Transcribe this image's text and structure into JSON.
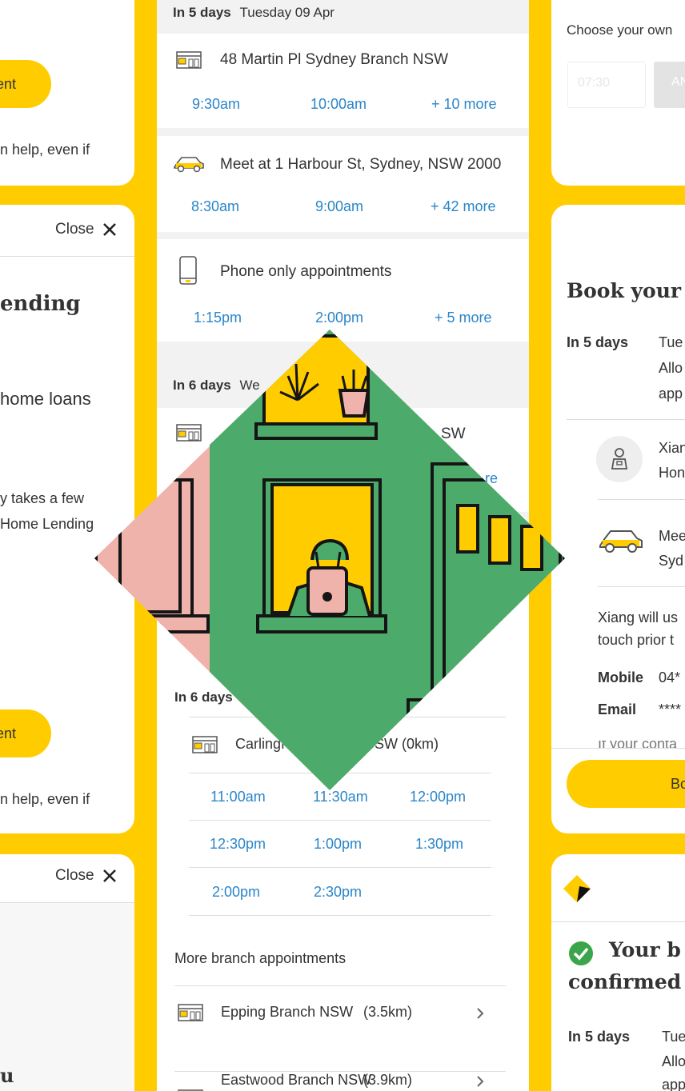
{
  "left": {
    "card1": {
      "button": "ment",
      "text": "n help, even if"
    },
    "card2": {
      "close": "Close",
      "title": "ending",
      "sub": "home loans",
      "para1": "y takes a few",
      "para2": "Home Lending",
      "button": "ment",
      "text": "n help, even if"
    },
    "card3": {
      "close": "Close",
      "bottom": "u"
    }
  },
  "middle": {
    "groups": [
      {
        "days": "In 5 days",
        "date": "Tuesday 09 Apr"
      },
      {
        "days": "In 6 days",
        "date": "We"
      }
    ],
    "options": [
      {
        "icon": "branch-icon",
        "label": "48 Martin Pl Sydney Branch NSW",
        "slots": [
          "9:30am",
          "10:00am",
          "+ 10 more"
        ]
      },
      {
        "icon": "car-icon",
        "label": "Meet at 1 Harbour St, Sydney, NSW 2000",
        "slots": [
          "8:30am",
          "9:00am",
          "+ 42 more"
        ]
      },
      {
        "icon": "phone-icon",
        "label": "Phone only appointments",
        "slots": [
          "1:15pm",
          "2:00pm",
          "+ 5 more"
        ]
      }
    ],
    "partial": {
      "sw": "SW",
      "more": "re"
    },
    "lower": {
      "days": "In 6 days",
      "branch": "Carlingf",
      "branch_suffix": "SW (0km)",
      "slots": [
        "11:00am",
        "11:30am",
        "12:00pm",
        "12:30pm",
        "1:00pm",
        "1:30pm",
        "2:00pm",
        "2:30pm"
      ],
      "more_header": "More branch appointments",
      "branches": [
        {
          "name": "Epping Branch NSW",
          "distance": "(3.5km)"
        },
        {
          "name": "Eastwood Branch NSW",
          "distance": "(3.9km)"
        }
      ]
    }
  },
  "right": {
    "card1": {
      "label": "Choose your own",
      "time_value": "07:30",
      "ampm": "AN"
    },
    "card2": {
      "title": "Book your",
      "days": "In 5 days",
      "date": "Tue",
      "allow1": "Allo",
      "allow2": "app",
      "person_name": "Xian",
      "person_role": "Hon",
      "meet1": "Mee",
      "meet2": "Syd",
      "note1": "Xiang will us",
      "note2": "touch prior t",
      "mobile_label": "Mobile",
      "mobile_value": "04*",
      "email_label": "Email",
      "email_value": "****",
      "cut_text": "If your conta",
      "button": "Bo"
    },
    "card3": {
      "title1": "Your b",
      "title2": "confirmed",
      "days": "In 5 days",
      "date": "Tue",
      "allow1": "Allo",
      "allow2": "app"
    }
  },
  "colors": {
    "brand_yellow": "#FFCC00",
    "link_blue": "#2a86c9",
    "green": "#3aa54a",
    "illus_green": "#4cab6a",
    "illus_pink": "#f0b3ab"
  }
}
